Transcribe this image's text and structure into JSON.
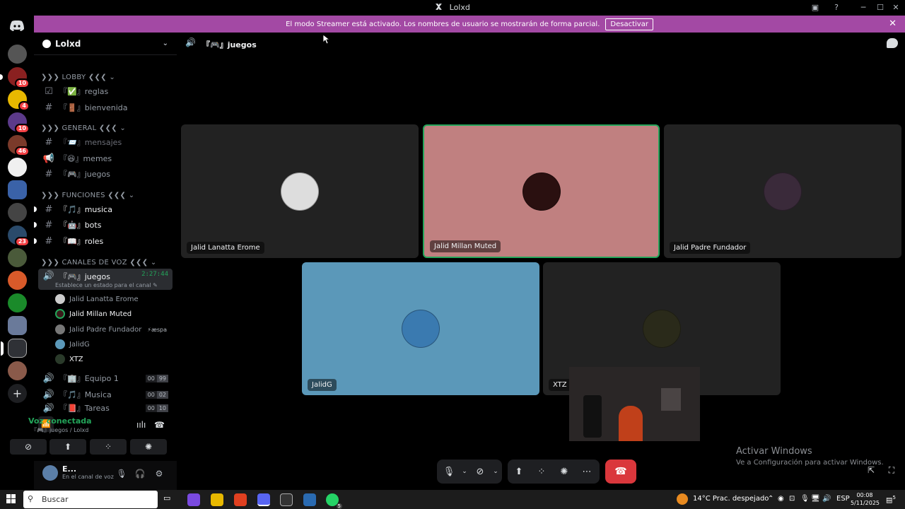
{
  "window": {
    "title": "Lolxd"
  },
  "banner": {
    "text": "El modo Streamer está activado. Los nombres de usuario se mostrarán de forma parcial.",
    "button": "Desactivar",
    "close": "✕"
  },
  "server_badges": [
    "10",
    "4",
    "10",
    "46",
    "23"
  ],
  "guild": {
    "name": "Lolxd"
  },
  "categories": {
    "lobby": "❯❯❯ LOBBY ❮❮❮ ⌄",
    "general": "❯❯❯ GENERAL ❮❮❮ ⌄",
    "funciones": "❯❯❯ FUNCIONES ❮❮❮ ⌄",
    "voz": "❯❯❯ CANALES DE VOZ ❮❮❮ ⌄"
  },
  "channels": {
    "reglas": "『✅』reglas",
    "bienvenida": "『🚪』bienvenida",
    "mensajes": "『📨』mensajes",
    "memes": "『😆』memes",
    "juegos_text": "『🎮』juegos",
    "musica": "『🎵』musica",
    "bots": "『🤖』bots",
    "roles": "『📖』roles",
    "juegos_voice": "『🎮』juegos",
    "juegos_timer": "2:27:44",
    "set_status": "Establece un estado para el canal ✎",
    "equipo1": "『🏢』Equipo 1",
    "equipo1_counts": [
      "00",
      "99"
    ],
    "musica_voice": "『🎵』Musica",
    "musica_counts": [
      "00",
      "02"
    ],
    "tareas": "『📕』Tareas",
    "tareas_counts": [
      "00",
      "10"
    ]
  },
  "voice_users": [
    {
      "name": "Jalid Lanatta Erome",
      "tag": ""
    },
    {
      "name": "Jalid Millan Muted",
      "tag": ""
    },
    {
      "name": "Jalid Padre Fundador",
      "tag": "⚡æspa"
    },
    {
      "name": "JalidG",
      "tag": ""
    },
    {
      "name": "XTZ",
      "tag": ""
    }
  ],
  "voice_panel": {
    "status": "Voz conectada",
    "channel": "『🎮』juegos / Lolxd"
  },
  "user": {
    "name": "E...",
    "status": "En el canal de voz"
  },
  "header": {
    "channel": "『🎮』juegos"
  },
  "tiles": [
    {
      "name": "Jalid Lanatta Erome"
    },
    {
      "name": "Jalid Millan Muted"
    },
    {
      "name": "Jalid Padre Fundador"
    },
    {
      "name": "JalidG"
    },
    {
      "name": "XTZ"
    }
  ],
  "watermark": {
    "line1": "Activar Windows",
    "line2": "Ve a Configuración para activar Windows."
  },
  "taskbar": {
    "search_placeholder": "Buscar",
    "weather": "14°C  Prac. despejado",
    "lang": "ESP",
    "time": "00:08",
    "date": "5/11/2025",
    "notif_count": "5",
    "whatsapp_badge": "5"
  },
  "colors": {
    "banner": "#a349a4",
    "speaking_border": "#23a55a",
    "tile_pink": "#c08080",
    "tile_blue": "#5b98b9",
    "tile_dark": "#222222",
    "hangup": "#da373c"
  }
}
